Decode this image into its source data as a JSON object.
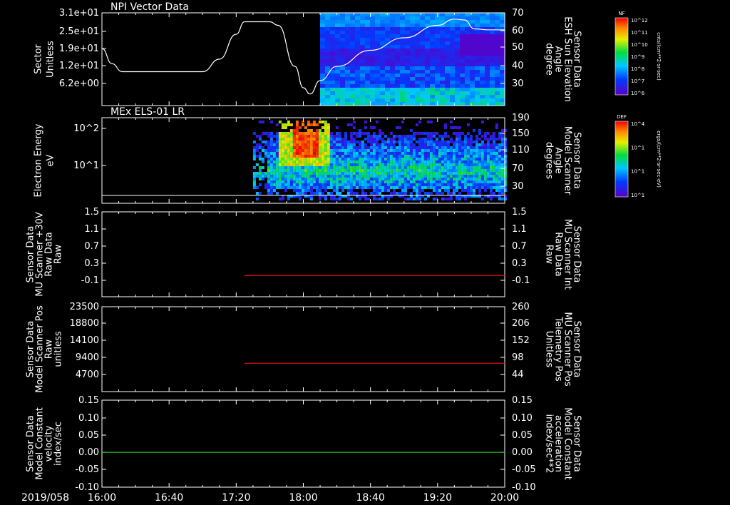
{
  "x_axis": {
    "date_label": "2019/058",
    "ticks": [
      "16:00",
      "16:40",
      "17:20",
      "18:00",
      "18:40",
      "19:20",
      "20:00"
    ],
    "range_minutes": [
      960,
      1200
    ]
  },
  "colorbars": [
    {
      "title": "NF",
      "unit": "cnts/(cm**2-sr-sec)",
      "tick_labels": [
        "10^12",
        "10^11",
        "10^10",
        "10^9",
        "10^8",
        "10^7",
        "10^6"
      ]
    },
    {
      "title": "DEF",
      "unit": "ergs/(cm**2-sr-sec-eV)",
      "tick_labels": [
        "10^4",
        "10^1",
        "10^1",
        "10^1"
      ]
    }
  ],
  "chart_data": [
    {
      "type": "line",
      "title": "NPI Vector Data",
      "left_label": [
        "Sector",
        "Unitless"
      ],
      "right_label": [
        "Sensor Data",
        "ESH Sun Elevation",
        "Angle",
        "degree"
      ],
      "left_ticks": [
        "3.1e+01",
        "2.5e+01",
        "1.9e+01",
        "1.2e+01",
        "6.2e+00"
      ],
      "right_ticks": [
        "70",
        "60",
        "50",
        "40",
        "30"
      ],
      "ylim_right": [
        18,
        70
      ],
      "spectrogram_start": "18:10",
      "series": [
        {
          "color": "#ffffff",
          "x": [
            "16:00",
            "16:06",
            "16:12",
            "17:00",
            "17:10",
            "17:20",
            "17:25",
            "17:40",
            "17:45",
            "17:55",
            "18:00",
            "18:04",
            "18:10",
            "18:20",
            "18:40",
            "19:00",
            "19:20",
            "19:30",
            "19:36",
            "19:42",
            "19:50",
            "20:00"
          ],
          "y": [
            50,
            41.5,
            37,
            37,
            44,
            58,
            65,
            65,
            63,
            40,
            28,
            24.5,
            32,
            40,
            49,
            56,
            63,
            66.5,
            66,
            61,
            60.5,
            60.5
          ]
        }
      ]
    },
    {
      "type": "heatmap",
      "title": "MEx ELS-01 LR",
      "left_label": [
        "Electron Energy",
        "eV"
      ],
      "right_label": [
        "Sensor Data",
        "Model Scanner",
        "Angle",
        "degrees"
      ],
      "left_ticks": [
        "10^2",
        "10^1"
      ],
      "right_ticks": [
        "190",
        "150",
        "110",
        "70",
        "30"
      ],
      "data_start": "17:30",
      "peak_time": "18:00",
      "baseline_right_value": 10
    },
    {
      "type": "line",
      "left_label": [
        "Sensor Data",
        "MU Scanner +30V",
        "Raw Data",
        "Raw"
      ],
      "right_label": [
        "Sensor Data",
        "MU Scanner Int",
        "Raw Data",
        "Raw"
      ],
      "left_ticks": [
        "1.5",
        "1.1",
        "0.7",
        "0.3",
        "-0.1"
      ],
      "right_ticks": [
        "1.5",
        "1.1",
        "0.7",
        "0.3",
        "-0.1"
      ],
      "ylim": [
        -0.5,
        1.5
      ],
      "series": [
        {
          "color": "#dd1111",
          "x": [
            "17:25",
            "20:00"
          ],
          "y": [
            0,
            0
          ]
        }
      ]
    },
    {
      "type": "line",
      "left_label": [
        "Sensor Data",
        "Model Scanner Pos",
        "Raw",
        "unitless"
      ],
      "right_label": [
        "Sensor Data",
        "MU Scanner Pos",
        "Telemetry Pos",
        "Unitless"
      ],
      "left_ticks": [
        "23500",
        "18800",
        "14100",
        "9400",
        "4700"
      ],
      "right_ticks": [
        "260",
        "206",
        "152",
        "98",
        "44"
      ],
      "ylim": [
        0,
        23500
      ],
      "series": [
        {
          "color": "#dd1111",
          "x": [
            "17:25",
            "20:00"
          ],
          "y": [
            7850,
            7850
          ]
        }
      ]
    },
    {
      "type": "line",
      "left_label": [
        "Sensor Data",
        "Model Constant",
        "velocity",
        "index/sec"
      ],
      "right_label": [
        "Sensor Data",
        "Model Constant",
        "acceleration",
        "index/sec**2"
      ],
      "left_ticks": [
        "0.15",
        "0.10",
        "0.05",
        "0.00",
        "-0.05",
        "-0.10"
      ],
      "right_ticks": [
        "0.15",
        "0.10",
        "0.05",
        "0.00",
        "-0.05",
        "-0.10"
      ],
      "ylim": [
        -0.1,
        0.15
      ],
      "series": [
        {
          "color": "#22cc22",
          "x": [
            "16:00",
            "20:00"
          ],
          "y": [
            0,
            0
          ]
        }
      ]
    }
  ]
}
